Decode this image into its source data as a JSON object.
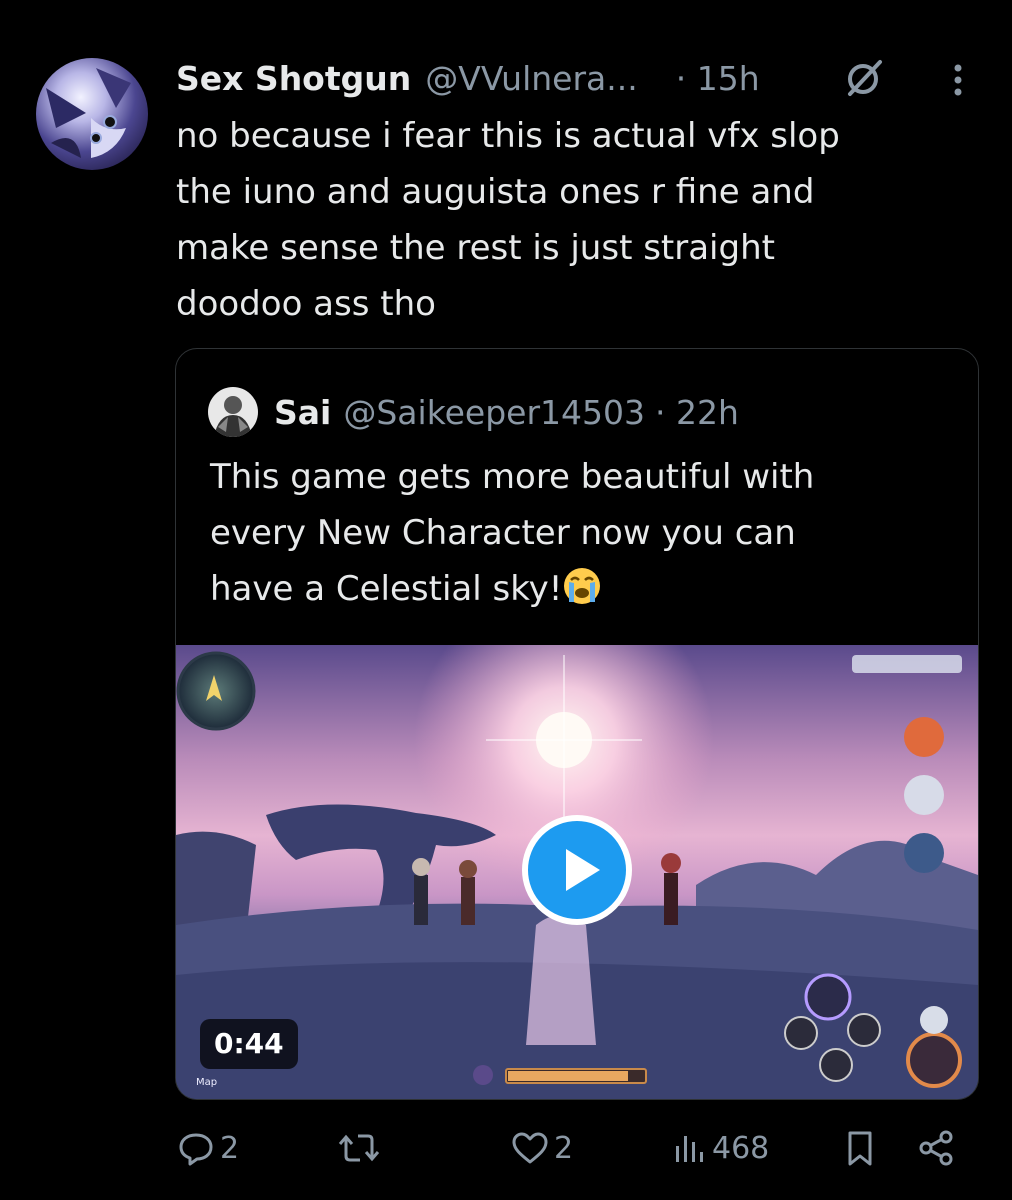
{
  "tweet": {
    "display_name": "Sex Shotgun",
    "handle": "@VVulnera...",
    "time": "· 15h",
    "text": "no because i fear this is actual vfx slop\nthe iuno and auguista ones r fine and\nmake sense the rest is just straight\ndoodoo ass tho",
    "icons": {
      "avatar": "avatar-anime-character",
      "grok": "grok-icon",
      "more": "more-vertical-icon"
    }
  },
  "quote": {
    "display_name": "Sai",
    "handle": "@Saikeeper14503",
    "time": "· 22h",
    "text": "This game gets more beautiful with\nevery New Character now you can\nhave a Celestial sky!",
    "emoji": "loudly-crying-face-emoji",
    "media": {
      "type": "video",
      "duration": "0:44",
      "minimap_label": "Map",
      "icons": [
        "play-icon",
        "minimap-icon",
        "character-portrait-icon",
        "skill-button-icon"
      ]
    }
  },
  "actions": {
    "replies": "2",
    "retweets": "",
    "likes": "2",
    "views": "468",
    "icons": [
      "reply-icon",
      "retweet-icon",
      "like-icon",
      "views-icon",
      "bookmark-icon",
      "share-icon"
    ]
  },
  "colors": {
    "background": "#000000",
    "text_primary": "#e7e9ea",
    "text_secondary": "#8b98a5",
    "border": "#2f3336",
    "accent": "#1d9bf0"
  }
}
